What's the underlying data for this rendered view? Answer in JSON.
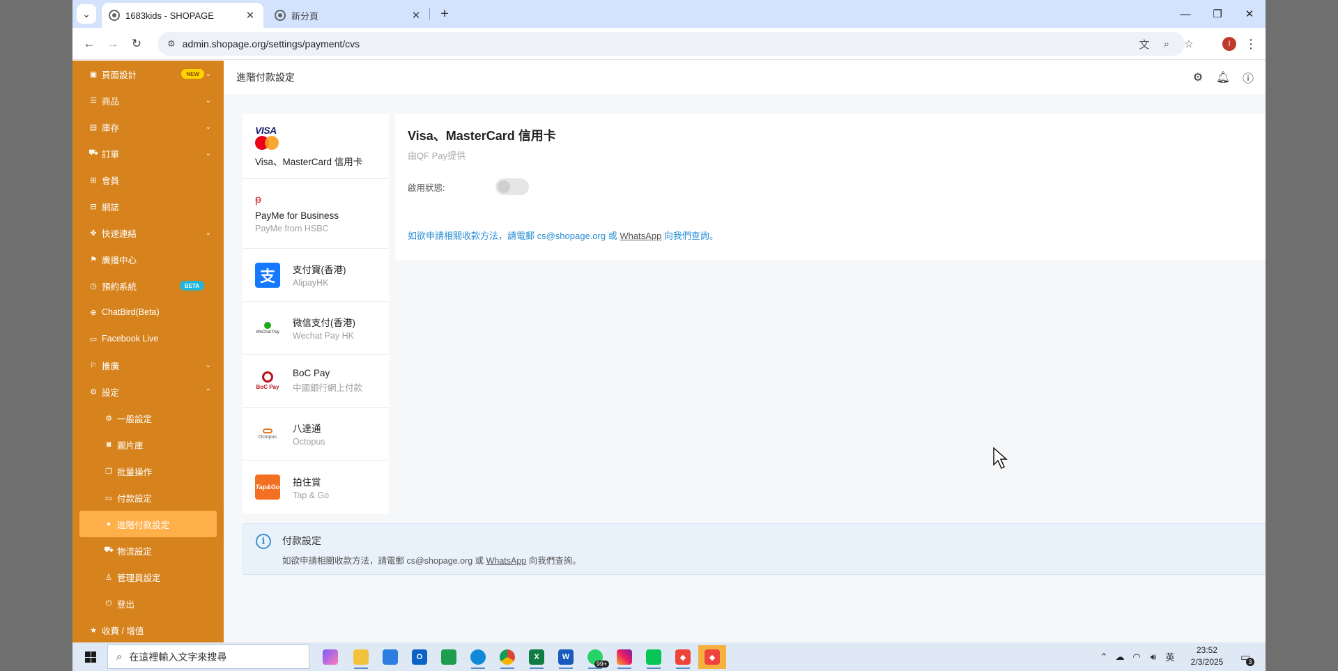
{
  "browser": {
    "tabs": [
      {
        "title": "1683kids - SHOPAGE",
        "active": true
      },
      {
        "title": "新分頁",
        "active": false
      }
    ],
    "url": "admin.shopage.org/settings/payment/cvs",
    "profile_initial": "I"
  },
  "sidebar": {
    "items": [
      {
        "label": "頁面設計",
        "icon": "layout-icon",
        "badge": "NEW",
        "chevron": true
      },
      {
        "label": "商品",
        "icon": "list-icon",
        "chevron": true
      },
      {
        "label": "庫存",
        "icon": "inventory-icon",
        "chevron": true
      },
      {
        "label": "訂單",
        "icon": "cart-icon",
        "chevron": true
      },
      {
        "label": "會員",
        "icon": "members-icon"
      },
      {
        "label": "網誌",
        "icon": "blog-icon"
      },
      {
        "label": "快速連結",
        "icon": "link-icon",
        "chevron": true
      },
      {
        "label": "廣播中心",
        "icon": "broadcast-icon"
      },
      {
        "label": "預約系統",
        "icon": "clock-icon",
        "badge": "BETA"
      },
      {
        "label": "ChatBird(Beta)",
        "icon": "globe-icon"
      },
      {
        "label": "Facebook Live",
        "icon": "video-icon"
      },
      {
        "label": "推廣",
        "icon": "promote-icon",
        "chevron": true
      },
      {
        "label": "設定",
        "icon": "gear-icon",
        "chevron": true,
        "expanded": true
      }
    ],
    "settings_sub": [
      {
        "label": "一般設定",
        "icon": "gear-icon"
      },
      {
        "label": "圖片庫",
        "icon": "camera-icon"
      },
      {
        "label": "批量操作",
        "icon": "copy-icon"
      },
      {
        "label": "付款設定",
        "icon": "payment-icon"
      },
      {
        "label": "進階付款設定",
        "icon": "advanced-payment-icon",
        "active": true
      },
      {
        "label": "物流設定",
        "icon": "truck-icon"
      },
      {
        "label": "管理員設定",
        "icon": "user-icon"
      },
      {
        "label": "登出",
        "icon": "logout-icon"
      }
    ],
    "bottom_item": {
      "label": "收費 / 增值",
      "icon": "star-icon"
    }
  },
  "header": {
    "title": "進階付款設定"
  },
  "payment_methods": [
    {
      "name": "Visa、MasterCard 信用卡",
      "sub": "",
      "logo": "visa-mastercard"
    },
    {
      "name": "PayMe for Business",
      "sub": "PayMe from HSBC",
      "logo": "payme"
    },
    {
      "name": "支付寶(香港)",
      "sub": "AlipayHK",
      "logo": "alipay",
      "logo_text": "支"
    },
    {
      "name": "微信支付(香港)",
      "sub": "Wechat Pay HK",
      "logo": "wechat",
      "logo_text": "WeChat Pay"
    },
    {
      "name": "BoC Pay",
      "sub": "中國銀行網上付款",
      "logo": "bocpay",
      "logo_text": "BoC Pay"
    },
    {
      "name": "八達通",
      "sub": "Octopus",
      "logo": "octopus",
      "logo_text": "Octopus"
    },
    {
      "name": "拍住賞",
      "sub": "Tap & Go",
      "logo": "tapgo",
      "logo_text": "Tap&Go"
    }
  ],
  "detail": {
    "title": "Visa、MasterCard 信用卡",
    "provider": "由QF Pay提供",
    "status_label": "啟用狀態:",
    "enabled": false,
    "contact_prefix": "如欲申請相關收款方法，請電郵 cs@shopage.org 或 ",
    "contact_link": "WhatsApp",
    "contact_suffix": " 向我們查詢。"
  },
  "info_box": {
    "title": "付款設定",
    "text_prefix": "如欲申請相關收款方法，請電郵 cs@shopage.org 或 ",
    "text_link": "WhatsApp",
    "text_suffix": " 向我們查詢。"
  },
  "taskbar": {
    "search_placeholder": "在這裡輸入文字來搜尋",
    "whatsapp_badge": "99+",
    "ime": "英",
    "time": "23:52",
    "date": "2/3/2025",
    "notifications": "3"
  },
  "colors": {
    "sidebar_bg": "#d7831d",
    "sidebar_active": "#ffb04a",
    "link_blue": "#2b8fd6",
    "info_bg": "#e9f2fb"
  }
}
